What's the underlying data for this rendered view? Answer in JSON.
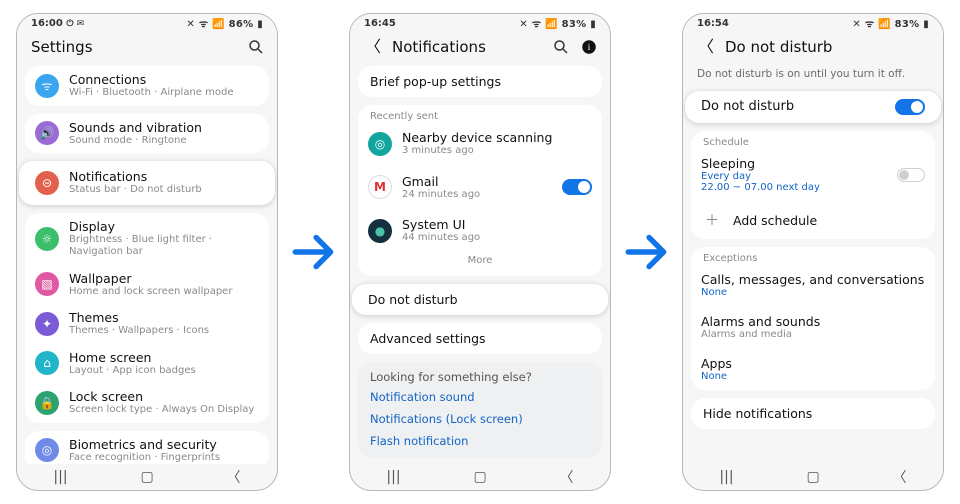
{
  "arrows": {
    "color": "#1175e8"
  },
  "p1": {
    "status": {
      "time": "16:00",
      "left_extra": "⏻ ✉",
      "right": "✕ ᯤ 📶 86% ▮"
    },
    "header_title": "Settings",
    "items": [
      {
        "label": "Connections",
        "sub": "Wi-Fi · Bluetooth · Airplane mode",
        "color": "#3aa6f0",
        "glyph": "ᯤ"
      },
      {
        "label": "Sounds and vibration",
        "sub": "Sound mode · Ringtone",
        "color": "#9a6bd6",
        "glyph": "🔊"
      },
      {
        "label": "Notifications",
        "sub": "Status bar · Do not disturb",
        "color": "#e2604e",
        "glyph": "⊝",
        "highlighted": true
      },
      {
        "label": "Display",
        "sub": "Brightness · Blue light filter · Navigation bar",
        "color": "#3bbf6b",
        "glyph": "☼"
      },
      {
        "label": "Wallpaper",
        "sub": "Home and lock screen wallpaper",
        "color": "#e05aa3",
        "glyph": "▧"
      },
      {
        "label": "Themes",
        "sub": "Themes · Wallpapers · Icons",
        "color": "#7b5cd6",
        "glyph": "✦"
      },
      {
        "label": "Home screen",
        "sub": "Layout · App icon badges",
        "color": "#20b5c9",
        "glyph": "⌂"
      },
      {
        "label": "Lock screen",
        "sub": "Screen lock type · Always On Display",
        "color": "#2aa36e",
        "glyph": "🔒"
      },
      {
        "label": "Biometrics and security",
        "sub": "Face recognition · Fingerprints",
        "color": "#6f8be6",
        "glyph": "◎"
      }
    ]
  },
  "p2": {
    "status": {
      "time": "16:45",
      "left_extra": "",
      "right": "✕ ᯤ 📶 83% ▮"
    },
    "header_title": "Notifications",
    "brief": "Brief pop-up settings",
    "recent_label": "Recently sent",
    "recent": [
      {
        "label": "Nearby device scanning",
        "sub": "3 minutes ago",
        "color": "#12a5a0",
        "glyph": "◎"
      },
      {
        "label": "Gmail",
        "sub": "24 minutes ago",
        "color": "#ffffff",
        "glyph": "M",
        "toggle": true,
        "fg": "#d33"
      },
      {
        "label": "System UI",
        "sub": "44 minutes ago",
        "color": "#0a1b2a",
        "glyph": "●"
      }
    ],
    "more": "More",
    "dnd": "Do not disturb",
    "advanced": "Advanced settings",
    "looking": "Looking for something else?",
    "links": [
      "Notification sound",
      "Notifications (Lock screen)",
      "Flash notification"
    ]
  },
  "p3": {
    "status": {
      "time": "16:54",
      "left_extra": "",
      "right": "✕ ᯤ 📶 83% ▮"
    },
    "header_title": "Do not disturb",
    "status_text": "Do not disturb is on until you turn it off.",
    "master": {
      "label": "Do not disturb",
      "on": true
    },
    "schedule_label": "Schedule",
    "sleeping": {
      "label": "Sleeping",
      "sub1": "Every day",
      "sub2": "22.00 ~ 07.00 next day"
    },
    "add_schedule": "Add schedule",
    "exceptions_label": "Exceptions",
    "exceptions": [
      {
        "label": "Calls, messages, and conversations",
        "sub": "None",
        "sub_accent": true
      },
      {
        "label": "Alarms and sounds",
        "sub": "Alarms and media",
        "sub_accent": false
      },
      {
        "label": "Apps",
        "sub": "None",
        "sub_accent": true
      }
    ],
    "hide": "Hide notifications"
  }
}
